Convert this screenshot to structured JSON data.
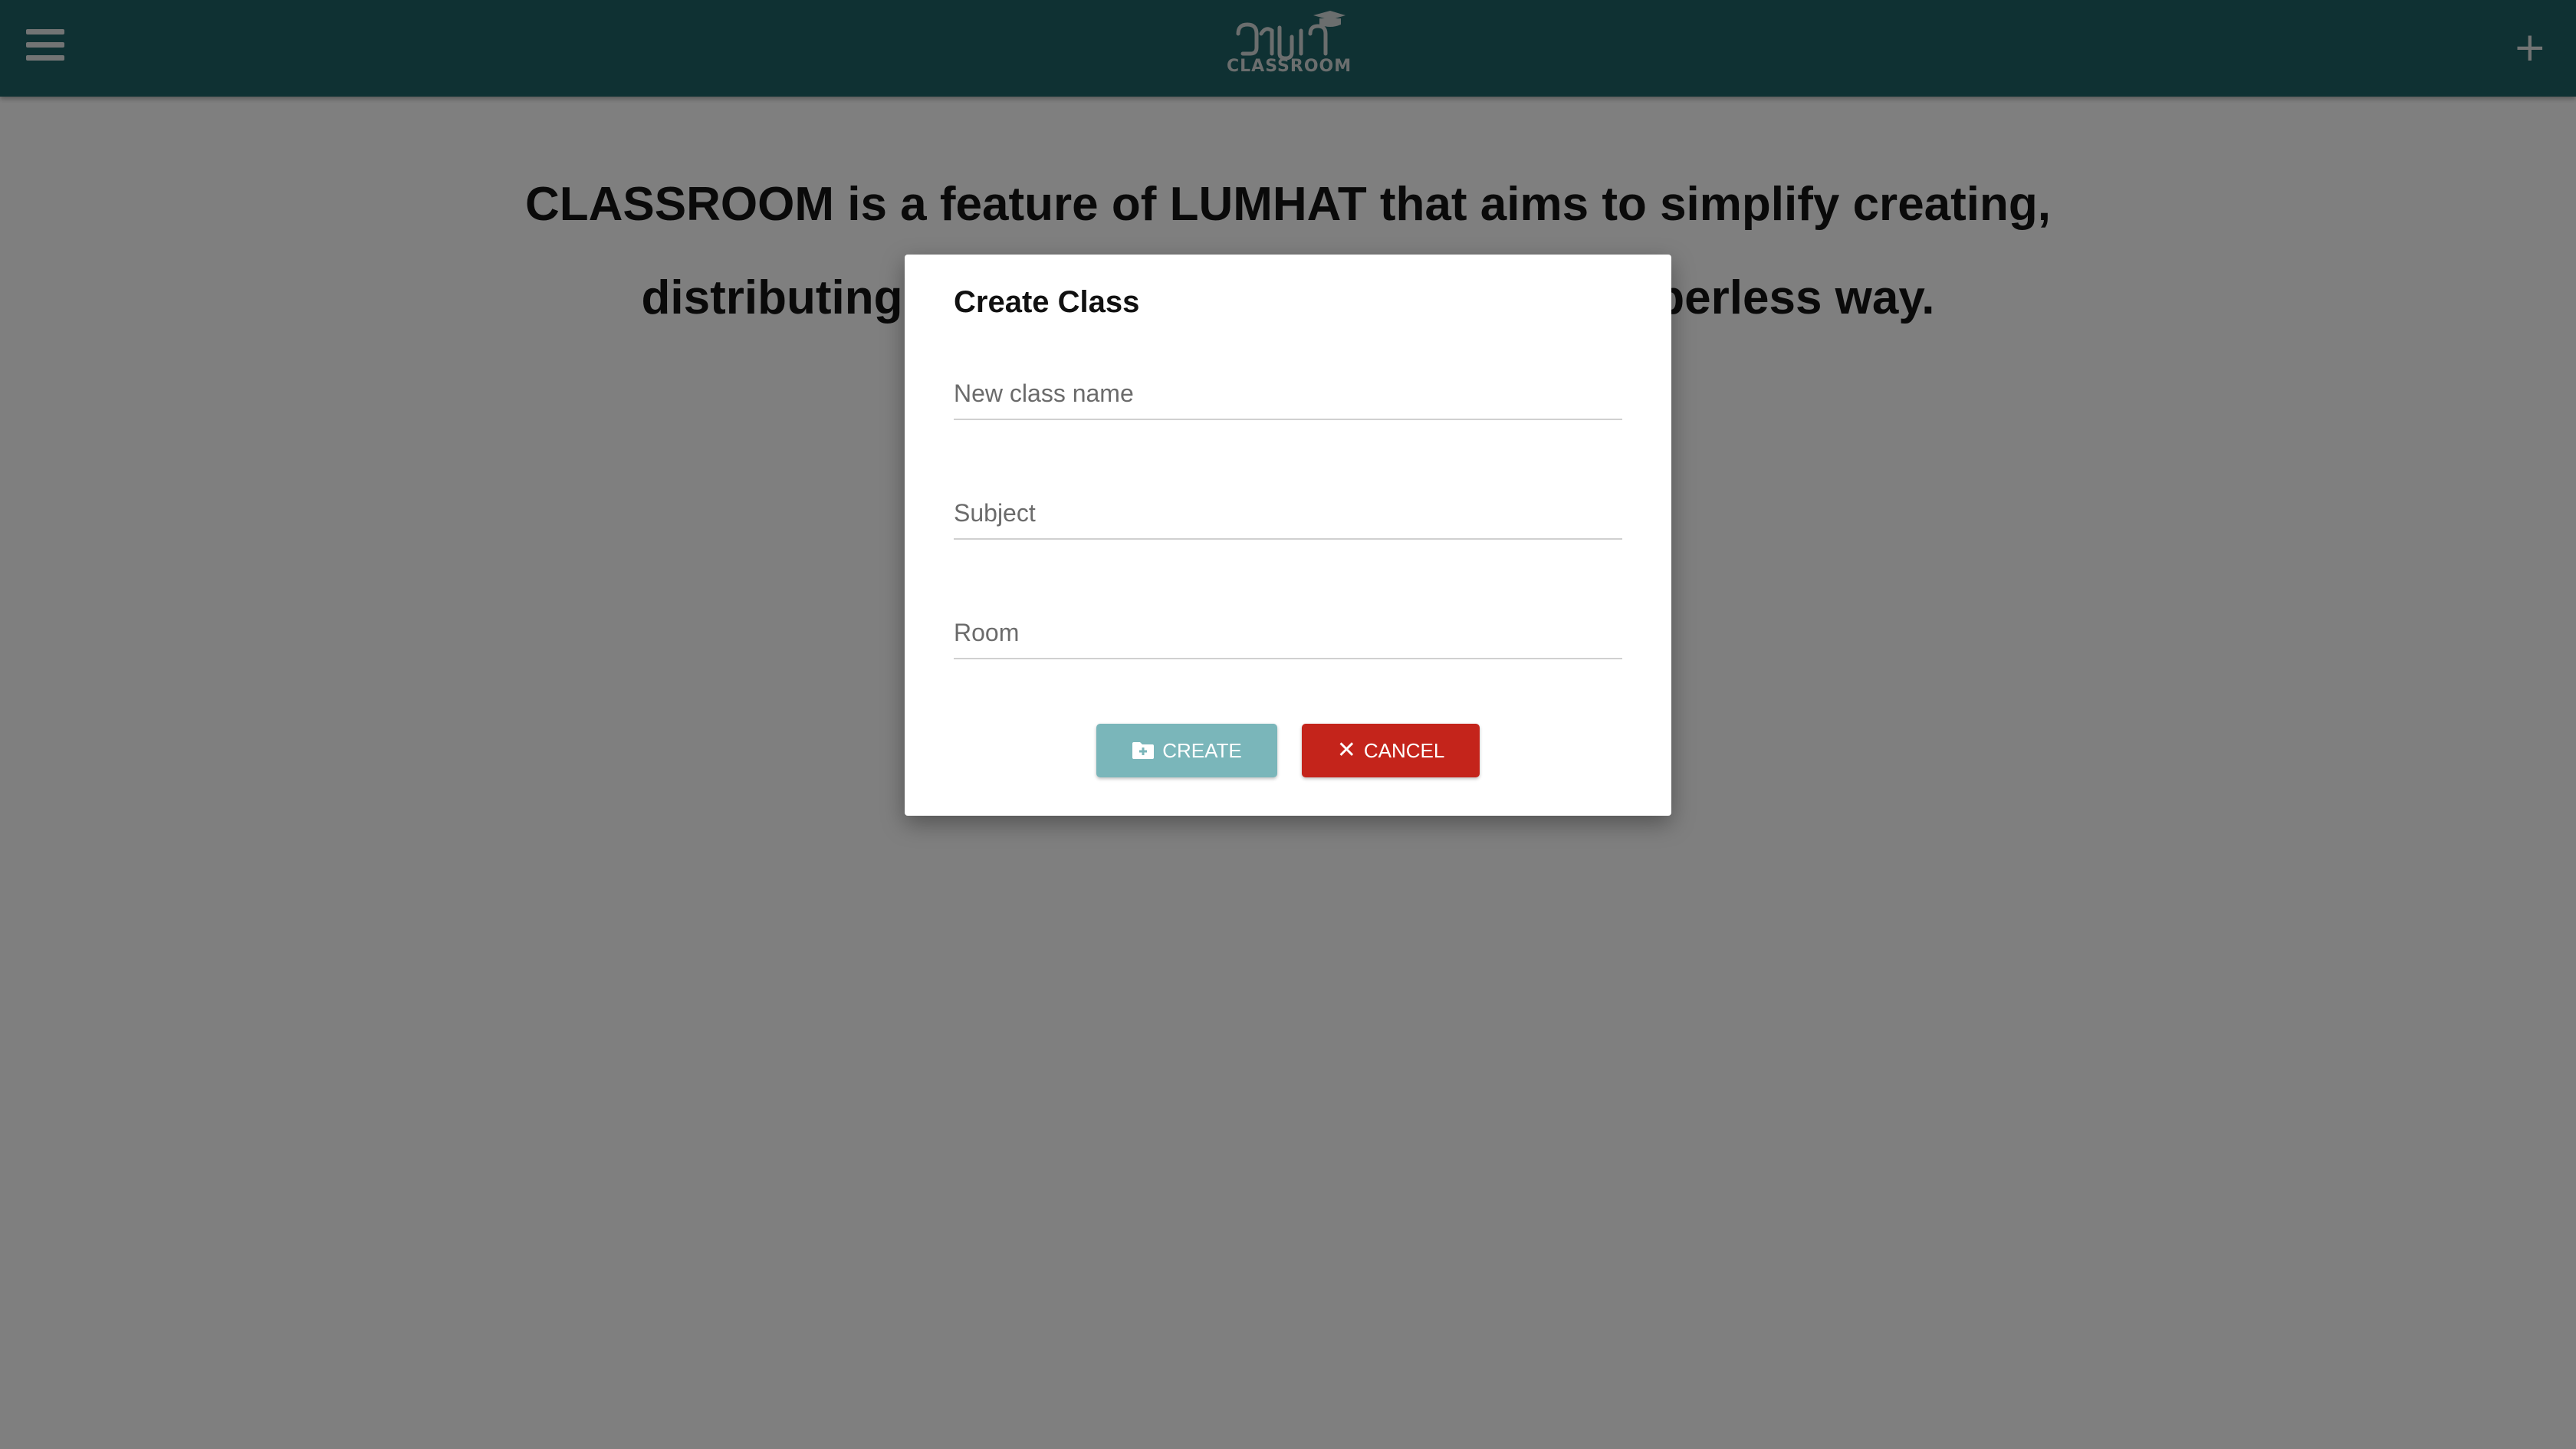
{
  "header": {
    "menu_icon": "hamburger-menu-icon",
    "logo_text": "CLASSROOM",
    "add_icon": "plus-icon",
    "add_symbol": "+"
  },
  "main": {
    "intro_text": "CLASSROOM is a feature of LUMHAT that aims to simplify creating, distributing and grading assignments in a paperless way."
  },
  "dialog": {
    "title": "Create Class",
    "fields": {
      "class_name": {
        "placeholder": "New class name",
        "value": ""
      },
      "subject": {
        "placeholder": "Subject",
        "value": ""
      },
      "room": {
        "placeholder": "Room",
        "value": ""
      }
    },
    "create_label": "CREATE",
    "create_icon": "folder-plus-icon",
    "cancel_label": "CANCEL",
    "cancel_icon": "close-icon",
    "cancel_symbol": "✕"
  },
  "colors": {
    "header_bg": "#1f6266",
    "create_button": "#7ab6ba",
    "cancel_button": "#c4241b",
    "overlay": "rgba(0,0,0,0.5)"
  }
}
